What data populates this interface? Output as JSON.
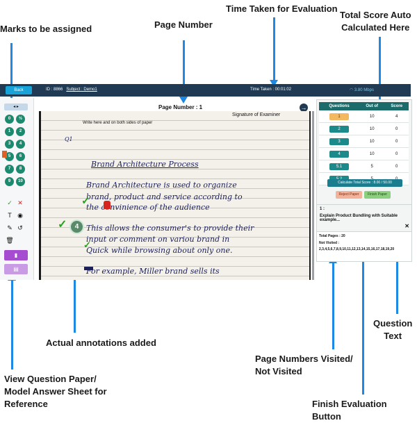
{
  "callouts": {
    "marks": "Marks to be assigned",
    "page_number": "Page Number",
    "time_taken": "Time Taken for Evaluation",
    "total_score_line1": "Total Score Auto",
    "total_score_line2": "Calculated Here",
    "annotations": "Actual annotations added",
    "visited_line1": "Page Numbers Visited/",
    "visited_line2": "Not Visited",
    "view_qp_line1": "View Question Paper/",
    "view_qp_line2": "Model Answer Sheet for",
    "view_qp_line3": "Reference",
    "question_text_line1": "Question",
    "question_text_line2": "Text",
    "finish_button": "Finish Evaluation Button"
  },
  "topbar": {
    "back_label": "Back",
    "id_label": "ID : 8866",
    "subject_label": "Subject : Demo1",
    "time_label": "Time Taken : 00:01:02",
    "speed_label": "3.80 Mbps"
  },
  "toolbar": {
    "marks": [
      "0",
      "½",
      "1",
      "2",
      "3",
      "4",
      "5",
      "6",
      "7",
      "8",
      "9",
      "10"
    ]
  },
  "viewer": {
    "page_number_label": "Page Number : 1",
    "signature_label": "Signature of Examiner",
    "write_hint": "Write here and on both sides of paper",
    "q_label": "Q1",
    "line_1": "Brand Architecture Process",
    "line_2": "Brand Architecture is used to organize",
    "line_3": "brand, product and service according to",
    "line_4": "the convinience of the audience",
    "line_5": "This allows the consumer's to provide their",
    "line_6": "input or comment on variou brand in",
    "line_7": "Quick while browsing about only one.",
    "line_8": "For example, Miller brand sells its",
    "annotation_number": "4"
  },
  "question_table": {
    "headers": [
      "Questions",
      "Out of",
      "Score"
    ],
    "rows": [
      {
        "q": "1",
        "out_of": "10",
        "score": "4"
      },
      {
        "q": "2",
        "out_of": "10",
        "score": "0"
      },
      {
        "q": "3",
        "out_of": "10",
        "score": "0"
      },
      {
        "q": "4",
        "out_of": "10",
        "score": "0"
      },
      {
        "q": "5.1",
        "out_of": "5",
        "score": "0"
      },
      {
        "q": "5.2",
        "out_of": "5",
        "score": "0"
      }
    ]
  },
  "actions": {
    "calculate_label": "Calculate Total Score : 8.00 / 50.00",
    "reject_label": "Reject Paper",
    "finish_label": "Finish Paper"
  },
  "question_text": {
    "number": "1 :",
    "text": "Explain Product Bundling with Suitable example..."
  },
  "pages": {
    "total": "Total Pages : 20",
    "not_visited_label": "Not Visited :",
    "not_visited_list": "2,3,4,5,6,7,8,9,10,11,12,13,14,15,16,17,18,19,20"
  },
  "colors": {
    "accent": "#1e88e5",
    "topbar": "#1f3a52",
    "mark_green": "#1c8a6e",
    "toolbar_purple": "#c27be0"
  }
}
